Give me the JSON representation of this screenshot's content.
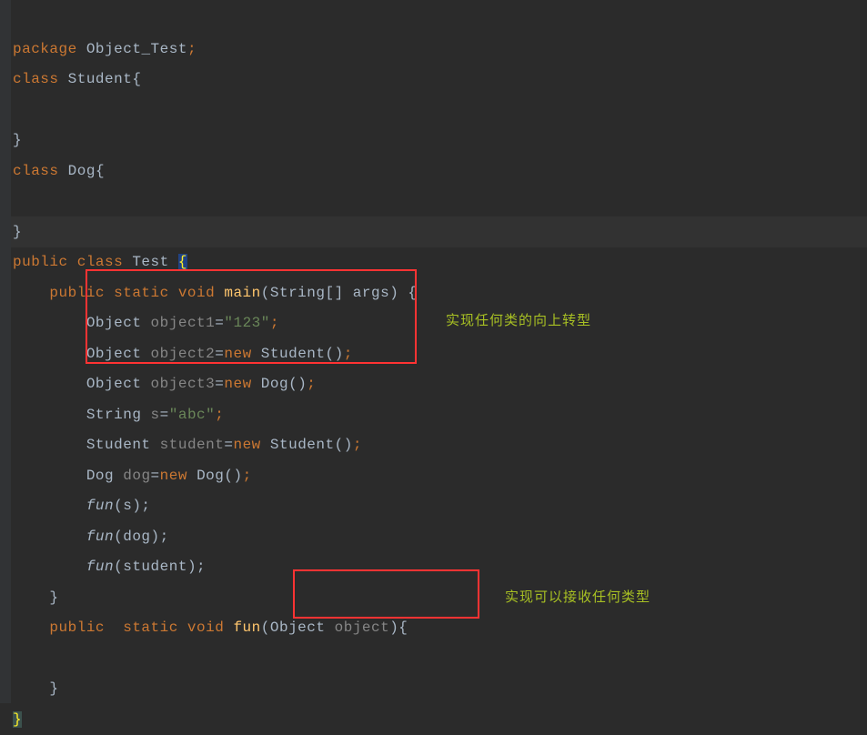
{
  "code": {
    "l1_kw1": "package",
    "l1_pkg": "Object_Test",
    "l1_semi": ";",
    "l2_kw1": "class",
    "l2_name": "Student",
    "l2_brace": "{",
    "l4_brace": "}",
    "l5_kw1": "class",
    "l5_name": "Dog",
    "l5_brace": "{",
    "l7_brace": "}",
    "l8_kw1": "public class",
    "l8_name": "Test",
    "l8_brace": "{",
    "l9_indent": "    ",
    "l9_kw": "public static void",
    "l9_method": "main",
    "l9_paren1": "(",
    "l9_param": "String[] args",
    "l9_paren2": ") {",
    "l10_indent": "        ",
    "l10_type": "Object",
    "l10_var": "object1",
    "l10_eq": "=",
    "l10_val": "\"123\"",
    "l10_semi": ";",
    "l11_indent": "        ",
    "l11_type": "Object",
    "l11_var": "object2",
    "l11_eq": "=",
    "l11_kw": "new",
    "l11_ctor": "Student()",
    "l11_semi": ";",
    "l12_indent": "        ",
    "l12_type": "Object",
    "l12_var": "object3",
    "l12_eq": "=",
    "l12_kw": "new",
    "l12_ctor": "Dog()",
    "l12_semi": ";",
    "l13_indent": "        ",
    "l13_type": "String",
    "l13_var": "s",
    "l13_eq": "=",
    "l13_val": "\"abc\"",
    "l13_semi": ";",
    "l14_indent": "        ",
    "l14_type": "Student",
    "l14_var": "student",
    "l14_eq": "=",
    "l14_kw": "new",
    "l14_ctor": "Student()",
    "l14_semi": ";",
    "l15_indent": "        ",
    "l15_type": "Dog",
    "l15_var": "dog",
    "l15_eq": "=",
    "l15_kw": "new",
    "l15_ctor": "Dog()",
    "l15_semi": ";",
    "l16_indent": "        ",
    "l16_fn": "fun",
    "l16_arg": "(s);",
    "l17_indent": "        ",
    "l17_fn": "fun",
    "l17_arg": "(dog);",
    "l18_indent": "        ",
    "l18_fn": "fun",
    "l18_arg": "(student);",
    "l19_indent": "    ",
    "l19_brace": "}",
    "l20_indent": "    ",
    "l20_kw": "public  static void",
    "l20_method": "fun",
    "l20_paren1": "(",
    "l20_ptype": "Object",
    "l20_pvar": "object",
    "l20_paren2": "){",
    "l22_indent": "    ",
    "l22_brace": "}",
    "l23_brace": "}"
  },
  "annotations": {
    "a1": "实现任何类的向上转型",
    "a2": "实现可以接收任何类型"
  }
}
